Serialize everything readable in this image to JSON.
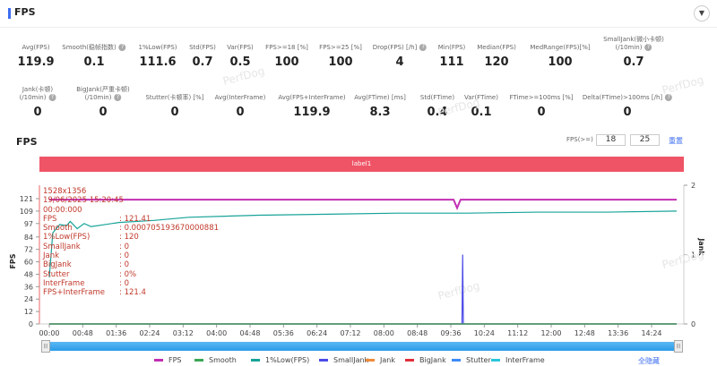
{
  "header": {
    "title": "FPS",
    "collapse_icon": "chevron-down-icon"
  },
  "metrics_row1": [
    {
      "label": "Avg(FPS)",
      "value": "119.9",
      "help": false
    },
    {
      "label": "Smooth(稳帧指数)",
      "value": "0.1",
      "help": true
    },
    {
      "label": "1%Low(FPS)",
      "value": "111.6",
      "help": false
    },
    {
      "label": "Std(FPS)",
      "value": "0.7",
      "help": false
    },
    {
      "label": "Var(FPS)",
      "value": "0.5",
      "help": false
    },
    {
      "label": "FPS>=18 [%]",
      "value": "100",
      "help": false
    },
    {
      "label": "FPS>=25 [%]",
      "value": "100",
      "help": false
    },
    {
      "label": "Drop(FPS) [/h]",
      "value": "4",
      "help": true
    },
    {
      "label": "Min(FPS)",
      "value": "111",
      "help": false
    },
    {
      "label": "Median(FPS)",
      "value": "120",
      "help": false
    },
    {
      "label": "MedRange(FPS)[%]",
      "value": "100",
      "help": false
    },
    {
      "label": "SmallJank(微小卡顿)\n(/10min)",
      "value": "0.7",
      "help": true
    }
  ],
  "metrics_row2": [
    {
      "label": "Jank(卡顿)\n(/10min)",
      "value": "0",
      "help": true
    },
    {
      "label": "BigJank(严重卡顿)\n(/10min)",
      "value": "0",
      "help": true
    },
    {
      "label": "Stutter(卡顿率) [%]",
      "value": "0",
      "help": false
    },
    {
      "label": "Avg(InterFrame)",
      "value": "0",
      "help": false
    },
    {
      "label": "Avg(FPS+InterFrame)",
      "value": "119.9",
      "help": false
    },
    {
      "label": "Avg(FTime) [ms]",
      "value": "8.3",
      "help": false
    },
    {
      "label": "Std(FTime)",
      "value": "0.4",
      "help": false
    },
    {
      "label": "Var(FTime)",
      "value": "0.1",
      "help": false
    },
    {
      "label": "FTime>=100ms [%]",
      "value": "0",
      "help": false
    },
    {
      "label": "Delta(FTime)>100ms [/h]",
      "value": "0",
      "help": true
    }
  ],
  "chart": {
    "title": "FPS",
    "threshold_label": "FPS(>=)",
    "threshold1": "18",
    "threshold2": "25",
    "reset": "重置",
    "label_bar": "label1",
    "hide_all": "全隐藏"
  },
  "tooltip": {
    "resolution": "1528x1356",
    "datetime": "19/06/2025 15:20:45",
    "time": "00:00:000",
    "rows": [
      [
        "FPS",
        ": 121.41"
      ],
      [
        "Smooth",
        ": 0.000705193670000881"
      ],
      [
        "1%Low(FPS)",
        ": 120"
      ],
      [
        "SmallJank",
        ": 0"
      ],
      [
        "Jank",
        ": 0"
      ],
      [
        "BigJank",
        ": 0"
      ],
      [
        "Stutter",
        ": 0%"
      ],
      [
        "InterFrame",
        ": 0"
      ],
      [
        "FPS+InterFrame",
        ": 121.4"
      ]
    ]
  },
  "chart_data": {
    "type": "line",
    "ylabel": "FPS",
    "y2label": "Jank",
    "yticks": [
      "0",
      "12",
      "24",
      "36",
      "48",
      "60",
      "72",
      "84",
      "97",
      "109",
      "121"
    ],
    "y2ticks": [
      "0",
      "1",
      "2"
    ],
    "xticks": [
      "00:00",
      "00:48",
      "01:36",
      "02:24",
      "03:12",
      "04:00",
      "04:48",
      "05:36",
      "06:24",
      "07:12",
      "08:00",
      "08:48",
      "09:36",
      "10:24",
      "11:12",
      "12:00",
      "12:48",
      "13:36",
      "14:24"
    ],
    "series": [
      {
        "name": "FPS",
        "color": "#c22fb3",
        "axis": "left",
        "x": [
          0,
          60,
          120,
          300,
          600,
          580,
          585,
          590,
          900
        ],
        "y": [
          120,
          120,
          120,
          120,
          120,
          120,
          112,
          120,
          120
        ]
      },
      {
        "name": "Smooth",
        "color": "#3aa757",
        "axis": "left",
        "x": [
          0,
          900
        ],
        "y": [
          0,
          0
        ]
      },
      {
        "name": "1%Low(FPS)",
        "color": "#17a398",
        "axis": "left",
        "x": [
          0,
          5,
          15,
          25,
          30,
          40,
          50,
          60,
          80,
          100,
          150,
          200,
          300,
          400,
          500,
          600,
          700,
          800,
          900
        ],
        "y": [
          45,
          88,
          96,
          95,
          99,
          92,
          97,
          94,
          96,
          98,
          100,
          103,
          105,
          106,
          107,
          107,
          108,
          108,
          109
        ]
      },
      {
        "name": "SmallJank",
        "color": "#4b4be8",
        "axis": "right",
        "x": [
          0,
          592,
          593,
          594,
          900
        ],
        "y": [
          0,
          0,
          1,
          0,
          0
        ]
      },
      {
        "name": "Jank",
        "color": "#f08c3a",
        "axis": "right",
        "x": [
          0,
          900
        ],
        "y": [
          0,
          0
        ]
      },
      {
        "name": "BigJank",
        "color": "#e0303b",
        "axis": "right",
        "x": [
          0,
          900
        ],
        "y": [
          0,
          0
        ]
      },
      {
        "name": "Stutter",
        "color": "#3d8af7",
        "axis": "right",
        "x": [
          0,
          900
        ],
        "y": [
          0,
          0
        ]
      },
      {
        "name": "InterFrame",
        "color": "#2ac6dc",
        "axis": "left",
        "x": [
          0,
          900
        ],
        "y": [
          0,
          0
        ]
      }
    ]
  }
}
